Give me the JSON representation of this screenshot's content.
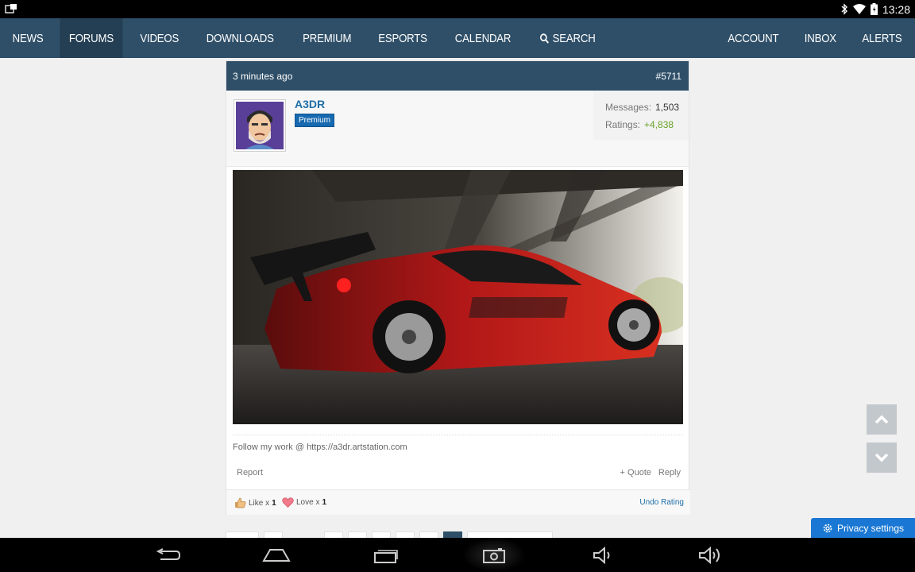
{
  "status_bar": {
    "time": "13:28"
  },
  "nav": {
    "left_items": [
      {
        "label": "NEWS"
      },
      {
        "label": "FORUMS"
      },
      {
        "label": "VIDEOS"
      },
      {
        "label": "DOWNLOADS"
      },
      {
        "label": "PREMIUM"
      },
      {
        "label": "ESPORTS"
      },
      {
        "label": "CALENDAR"
      },
      {
        "label": "SEARCH"
      }
    ],
    "right_items": [
      {
        "label": "ACCOUNT"
      },
      {
        "label": "INBOX"
      },
      {
        "label": "ALERTS"
      }
    ]
  },
  "post": {
    "time_ago": "3 minutes ago",
    "number": "#5711",
    "user": {
      "name": "A3DR",
      "badge": "Premium",
      "messages_label": "Messages:",
      "messages": "1,503",
      "ratings_label": "Ratings:",
      "ratings": "+4,838"
    },
    "signature": "Follow my work @ https://a3dr.artstation.com",
    "actions": {
      "report": "Report",
      "quote": "+ Quote",
      "reply": "Reply"
    },
    "ratings_bar": {
      "like_label": "Like x",
      "like_count": "1",
      "love_label": "Love x",
      "love_count": "1",
      "undo": "Undo Rating"
    }
  },
  "privacy": {
    "label": "Privacy settings"
  },
  "colors": {
    "nav_bg": "#2f4f68",
    "accent_blue": "#1f6ea8",
    "ratings_green": "#6aa42a",
    "privacy_blue": "#1a78d4"
  }
}
